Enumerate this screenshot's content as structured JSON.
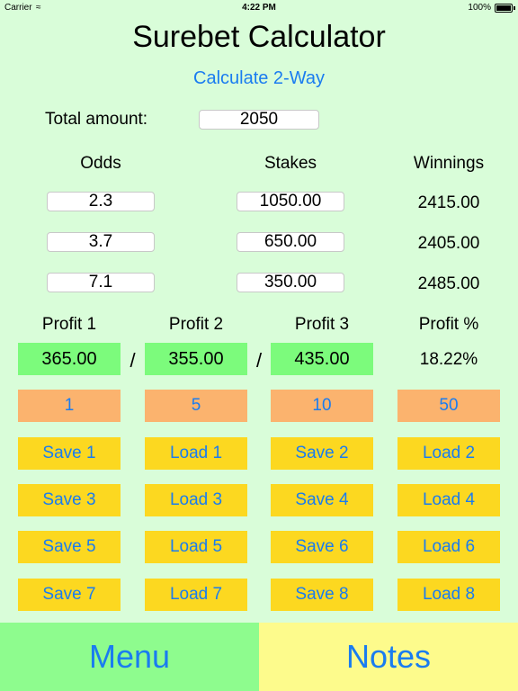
{
  "status": {
    "carrier": "Carrier",
    "time": "4:22 PM",
    "battery": "100%"
  },
  "title": "Surebet Calculator",
  "subtitle": "Calculate 2-Way",
  "total": {
    "label": "Total amount:",
    "value": "2050"
  },
  "headers": {
    "odds": "Odds",
    "stakes": "Stakes",
    "winnings": "Winnings"
  },
  "rows": [
    {
      "odds": "2.3",
      "stake": "1050.00",
      "winning": "2415.00"
    },
    {
      "odds": "3.7",
      "stake": "650.00",
      "winning": "2405.00"
    },
    {
      "odds": "7.1",
      "stake": "350.00",
      "winning": "2485.00"
    }
  ],
  "profit_headers": [
    "Profit 1",
    "Profit 2",
    "Profit 3",
    "Profit %"
  ],
  "profits": [
    "365.00",
    "355.00",
    "435.00"
  ],
  "profit_pct": "18.22%",
  "separator": "/",
  "round_buttons": [
    "1",
    "5",
    "10",
    "50"
  ],
  "slot_buttons": [
    [
      "Save 1",
      "Load 1",
      "Save 2",
      "Load 2"
    ],
    [
      "Save 3",
      "Load 3",
      "Save 4",
      "Load 4"
    ],
    [
      "Save 5",
      "Load 5",
      "Save 6",
      "Load 6"
    ],
    [
      "Save 7",
      "Load 7",
      "Save 8",
      "Load 8"
    ]
  ],
  "bottom": {
    "menu": "Menu",
    "notes": "Notes"
  },
  "colors": {
    "accent": "#1a7cf0",
    "background": "#d9fdd9",
    "profit_box": "#7cfb7c",
    "round_button": "#fbb36e",
    "slot_button": "#fcd820"
  }
}
